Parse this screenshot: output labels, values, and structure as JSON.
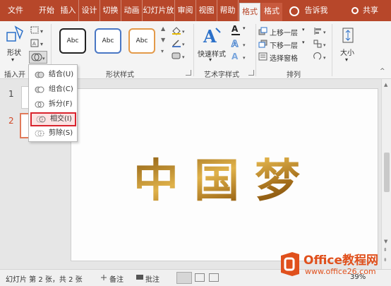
{
  "tabs": [
    {
      "label": "文件"
    },
    {
      "label": "开始"
    },
    {
      "label": "插入"
    },
    {
      "label": "设计"
    },
    {
      "label": "切换"
    },
    {
      "label": "动画"
    },
    {
      "label": "幻灯片放"
    },
    {
      "label": "审阅"
    },
    {
      "label": "视图"
    },
    {
      "label": "帮助"
    },
    {
      "label": "格式"
    },
    {
      "label": "格式"
    },
    {
      "label": "告诉我"
    },
    {
      "label": "共享"
    }
  ],
  "ribbon": {
    "insert_shapes": {
      "shape_label": "形状",
      "group_label": "插入开"
    },
    "shape_styles": {
      "group_label": "形状样式",
      "styles": [
        "Abc",
        "Abc",
        "Abc"
      ]
    },
    "wordart": {
      "quick_styles_label": "快速样式",
      "group_label": "艺术字样式",
      "text_fill_icon": "A"
    },
    "arrange": {
      "bring_forward": "上移一层",
      "send_backward": "下移一层",
      "selection_pane": "选择窗格",
      "group_label": "排列"
    },
    "size": {
      "label": "大小"
    }
  },
  "merge_menu": {
    "items": [
      {
        "label": "结合(U)"
      },
      {
        "label": "组合(C)"
      },
      {
        "label": "拆分(F)"
      },
      {
        "label": "相交(I)"
      },
      {
        "label": "剪除(S)"
      }
    ],
    "highlighted_index": 3
  },
  "thumbnails": {
    "numbers": [
      "1",
      "2"
    ]
  },
  "slide": {
    "title_text": "中国梦"
  },
  "status": {
    "slide_info": "幻灯片 第 2 张，共 2 张",
    "notes": "备注",
    "comments": "批注",
    "zoom": "39%"
  },
  "watermark": {
    "brand": "Office教程网",
    "url": "www.office26.com"
  },
  "colors": {
    "accent": "#b7472a",
    "highlight": "#d9232d",
    "gold": "#c8952a"
  }
}
